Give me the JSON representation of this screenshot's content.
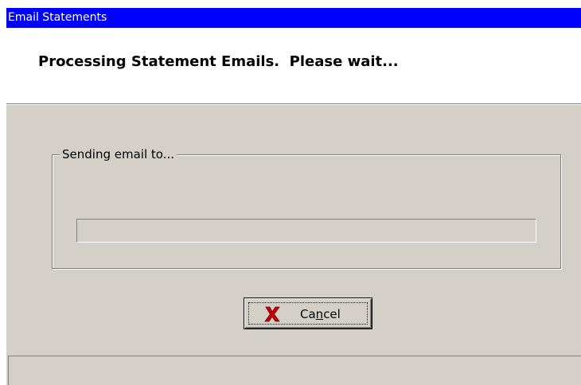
{
  "window": {
    "title": "Email Statements"
  },
  "header": {
    "message": "Processing Statement Emails.  Please wait..."
  },
  "group": {
    "legend": "Sending email to..."
  },
  "progress": {
    "fraction": 0
  },
  "buttons": {
    "cancel": {
      "label_pre": "Ca",
      "label_mnemonic": "n",
      "label_post": "cel",
      "icon": "red-x-icon"
    }
  },
  "statusbar": {
    "text": ""
  },
  "colors": {
    "titlebar": "#0000ff",
    "face": "#d4d0c8",
    "header_bg": "#ffffff",
    "cancel_icon": "#cc0000"
  }
}
